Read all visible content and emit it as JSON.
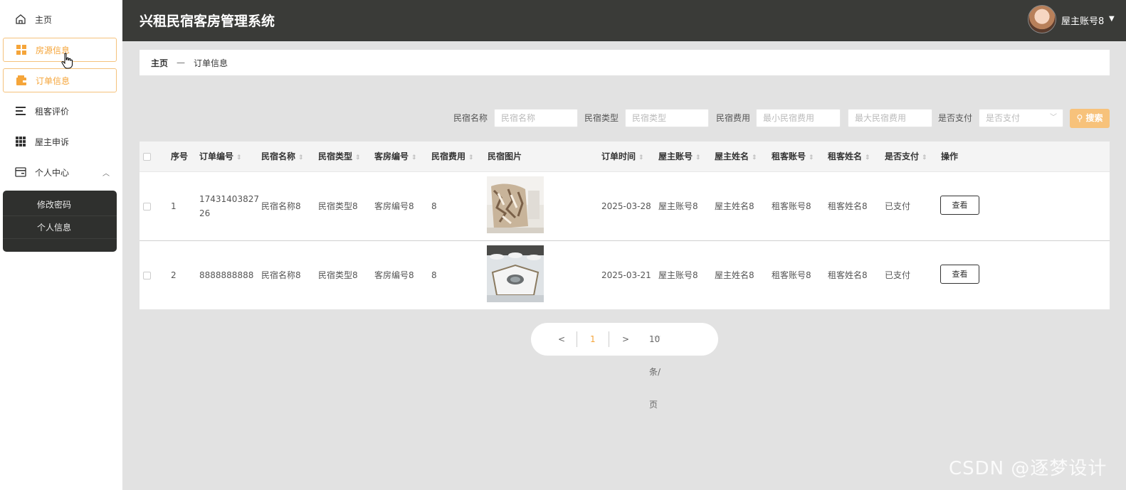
{
  "sidebar": {
    "items": [
      {
        "label": "主页",
        "icon": "home-icon"
      },
      {
        "label": "房源信息",
        "icon": "grid-icon"
      },
      {
        "label": "订单信息",
        "icon": "wallet-icon"
      },
      {
        "label": "租客评价",
        "icon": "list-icon"
      },
      {
        "label": "屋主申诉",
        "icon": "apps-icon"
      },
      {
        "label": "个人中心",
        "icon": "card-icon"
      }
    ],
    "submenu": [
      "修改密码",
      "个人信息"
    ]
  },
  "header": {
    "title": "兴租民宿客房管理系统",
    "user": "屋主账号8"
  },
  "breadcrumb": {
    "home": "主页",
    "sep": "—",
    "current": "订单信息"
  },
  "search": {
    "name_label": "民宿名称",
    "name_placeholder": "民宿名称",
    "type_label": "民宿类型",
    "type_placeholder": "民宿类型",
    "fee_label": "民宿费用",
    "fee_min_placeholder": "最小民宿费用",
    "fee_max_placeholder": "最大民宿费用",
    "paid_label": "是否支付",
    "paid_placeholder": "是否支付",
    "button": "搜索"
  },
  "table": {
    "headers": [
      "序号",
      "订单编号",
      "民宿名称",
      "民宿类型",
      "客房编号",
      "民宿费用",
      "民宿图片",
      "订单时间",
      "屋主账号",
      "屋主姓名",
      "租客账号",
      "租客姓名",
      "是否支付",
      "操作"
    ],
    "rows": [
      {
        "no": "1",
        "order": "1743140382726",
        "name": "民宿名称8",
        "type": "民宿类型8",
        "room": "客房编号8",
        "fee": "8",
        "time": "2025-03-28",
        "owner_acc": "屋主账号8",
        "owner_name": "屋主姓名8",
        "tenant_acc": "租客账号8",
        "tenant_name": "租客姓名8",
        "paid": "已支付",
        "action": "查看"
      },
      {
        "no": "2",
        "order": "8888888888",
        "name": "民宿名称8",
        "type": "民宿类型8",
        "room": "客房编号8",
        "fee": "8",
        "time": "2025-03-21",
        "owner_acc": "屋主账号8",
        "owner_name": "屋主姓名8",
        "tenant_acc": "租客账号8",
        "tenant_name": "租客姓名8",
        "paid": "已支付",
        "action": "查看"
      }
    ]
  },
  "pagination": {
    "prev": "<",
    "page": "1",
    "next": ">",
    "size": "10条/页"
  },
  "watermark": "CSDN @逐梦设计",
  "colors": {
    "accent": "#f5a53a",
    "header_bg": "#3a3b38",
    "main_bg": "#e2e2e2"
  }
}
